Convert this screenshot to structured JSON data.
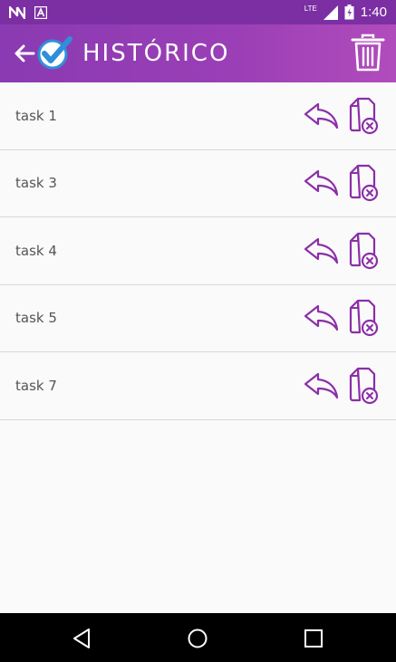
{
  "status_bar": {
    "time": "1:40",
    "network": "LTE",
    "left_icons": [
      "n-notification-icon",
      "a-notification-icon"
    ]
  },
  "app_bar": {
    "title": "HISTÓRICO",
    "accent_color": "#8a3ab2",
    "logo_color": "#2f8fd8"
  },
  "tasks": [
    {
      "label": "task 1"
    },
    {
      "label": "task 3"
    },
    {
      "label": "task 4"
    },
    {
      "label": "task 5"
    },
    {
      "label": "task 7"
    }
  ],
  "icon_color": "#8b2fa8"
}
